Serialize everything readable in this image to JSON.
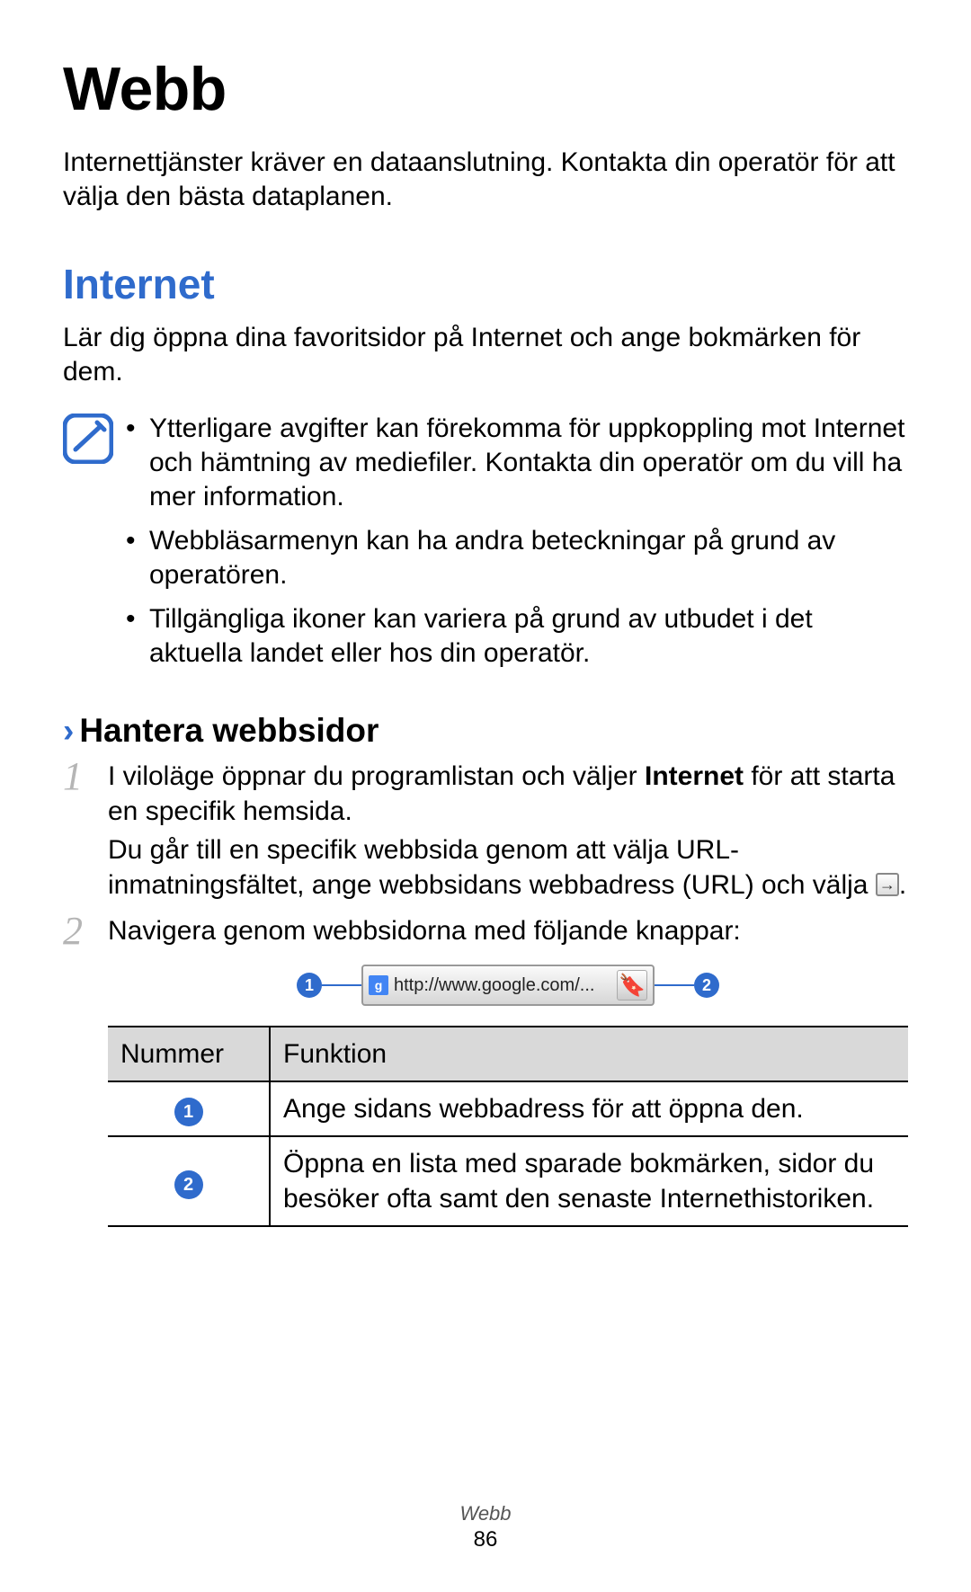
{
  "title": "Webb",
  "intro": "Internettjänster kräver en dataanslutning. Kontakta din operatör för att välja den bästa dataplanen.",
  "section_internet": {
    "heading": "Internet",
    "intro": "Lär dig öppna dina favoritsidor på Internet och ange bokmärken för dem.",
    "notes": [
      "Ytterligare avgifter kan förekomma för uppkoppling mot Internet och hämtning av mediefiler. Kontakta din operatör om du vill ha mer information.",
      "Webbläsarmenyn kan ha andra beteckningar på grund av operatören.",
      "Tillgängliga ikoner kan variera på grund av utbudet i det aktuella landet eller hos din operatör."
    ]
  },
  "subsection": {
    "chevron": "›",
    "heading": "Hantera webbsidor",
    "step1_a": "I viloläge öppnar du programlistan och väljer ",
    "step1_bold": "Internet",
    "step1_b": " för att starta en specifik hemsida.",
    "step1_para": "Du går till en specifik webbsida genom att välja URL-inmatningsfältet, ange webbsidans webbadress (URL) och välja ",
    "step1_dot": ".",
    "step2": "Navigera genom webbsidorna med följande knappar:",
    "step_num1": "1",
    "step_num2": "2"
  },
  "screenshot": {
    "url_text": "http://www.google.com/...",
    "callout1": "1",
    "callout2": "2"
  },
  "table": {
    "h1": "Nummer",
    "h2": "Funktion",
    "r1_badge": "1",
    "r1_text": "Ange sidans webbadress för att öppna den.",
    "r2_badge": "2",
    "r2_text": "Öppna en lista med sparade bokmärken, sidor du besöker ofta samt den senaste Internethistoriken."
  },
  "footer": {
    "section": "Webb",
    "page": "86"
  }
}
